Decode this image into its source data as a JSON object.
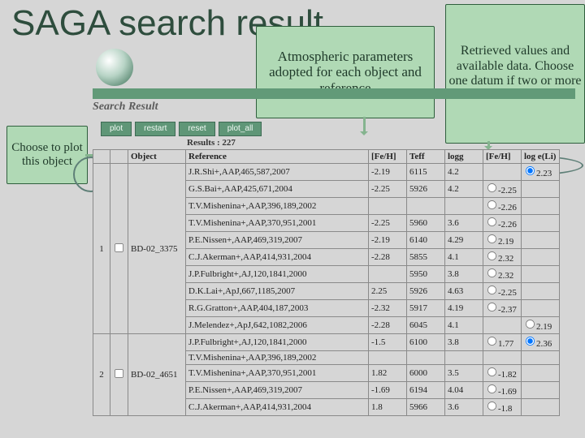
{
  "title": "SAGA search result",
  "callouts": {
    "params": "Atmospheric parameters adopted for each object and reference",
    "values": "Retrieved values and available data. Choose one datum if two or more data are available.",
    "plot": "Choose to plot this object"
  },
  "section_label": "Search Result",
  "buttons": [
    "plot",
    "restart",
    "reset",
    "plot_all"
  ],
  "results_count": "Results : 227",
  "columns": [
    "",
    "",
    "Object",
    "Reference",
    "[Fe/H]",
    "Teff",
    "logg",
    "[Fe/H]",
    "log e(Li)"
  ],
  "groups": [
    {
      "idx": "1",
      "object": "BD-02_3375",
      "rows": [
        {
          "ref": "J.R.Shi+,AAP,465,587,2007",
          "feh": "-2.19",
          "teff": "6115",
          "logg": "4.2",
          "feh2": "",
          "li": "2.23",
          "feh2_sel": false,
          "li_sel": true
        },
        {
          "ref": "G.S.Bai+,AAP,425,671,2004",
          "feh": "-2.25",
          "teff": "5926",
          "logg": "4.2",
          "feh2": "-2.25",
          "li": "",
          "feh2_sel": false,
          "li_sel": false
        },
        {
          "ref": "T.V.Mishenina+,AAP,396,189,2002",
          "feh": "",
          "teff": "",
          "logg": "",
          "feh2": "-2.26",
          "li": "",
          "feh2_sel": false,
          "li_sel": false
        },
        {
          "ref": "T.V.Mishenina+,AAP,370,951,2001",
          "feh": "-2.25",
          "teff": "5960",
          "logg": "3.6",
          "feh2": "-2.26",
          "li": "",
          "feh2_sel": false,
          "li_sel": false
        },
        {
          "ref": "P.E.Nissen+,AAP,469,319,2007",
          "feh": "-2.19",
          "teff": "6140",
          "logg": "4.29",
          "feh2": "2.19",
          "li": "",
          "feh2_sel": false,
          "li_sel": false
        },
        {
          "ref": "C.J.Akerman+,AAP,414,931,2004",
          "feh": "-2.28",
          "teff": "5855",
          "logg": "4.1",
          "feh2": "2.32",
          "li": "",
          "feh2_sel": false,
          "li_sel": false
        },
        {
          "ref": "J.P.Fulbright+,AJ,120,1841,2000",
          "feh": "",
          "teff": "5950",
          "logg": "3.8",
          "feh2": "2.32",
          "li": "",
          "feh2_sel": false,
          "li_sel": false
        },
        {
          "ref": "D.K.Lai+,ApJ,667,1185,2007",
          "feh": "2.25",
          "teff": "5926",
          "logg": "4.63",
          "feh2": "-2.25",
          "li": "",
          "feh2_sel": false,
          "li_sel": false
        },
        {
          "ref": "R.G.Gratton+,AAP,404,187,2003",
          "feh": "-2.32",
          "teff": "5917",
          "logg": "4.19",
          "feh2": "-2.37",
          "li": "",
          "feh2_sel": false,
          "li_sel": false
        },
        {
          "ref": "J.Melendez+,ApJ,642,1082,2006",
          "feh": "-2.28",
          "teff": "6045",
          "logg": "4.1",
          "feh2": "",
          "li": "2.19",
          "feh2_sel": false,
          "li_sel": false
        }
      ]
    },
    {
      "idx": "2",
      "object": "BD-02_4651",
      "rows": [
        {
          "ref": "J.P.Fulbright+,AJ,120,1841,2000",
          "feh": "-1.5",
          "teff": "6100",
          "logg": "3.8",
          "feh2": "1.77",
          "li": "2.36",
          "feh2_sel": false,
          "li_sel": true
        },
        {
          "ref": "T.V.Mishenina+,AAP,396,189,2002",
          "feh": "",
          "teff": "",
          "logg": "",
          "feh2": "",
          "li": "",
          "feh2_sel": false,
          "li_sel": false
        },
        {
          "ref": "T.V.Mishenina+,AAP,370,951,2001",
          "feh": "1.82",
          "teff": "6000",
          "logg": "3.5",
          "feh2": "-1.82",
          "li": "",
          "feh2_sel": false,
          "li_sel": false
        },
        {
          "ref": "P.E.Nissen+,AAP,469,319,2007",
          "feh": "-1.69",
          "teff": "6194",
          "logg": "4.04",
          "feh2": "-1.69",
          "li": "",
          "feh2_sel": false,
          "li_sel": false
        },
        {
          "ref": "C.J.Akerman+,AAP,414,931,2004",
          "feh": "1.8",
          "teff": "5966",
          "logg": "3.6",
          "feh2": "-1.8",
          "li": "",
          "feh2_sel": false,
          "li_sel": false
        }
      ]
    }
  ]
}
